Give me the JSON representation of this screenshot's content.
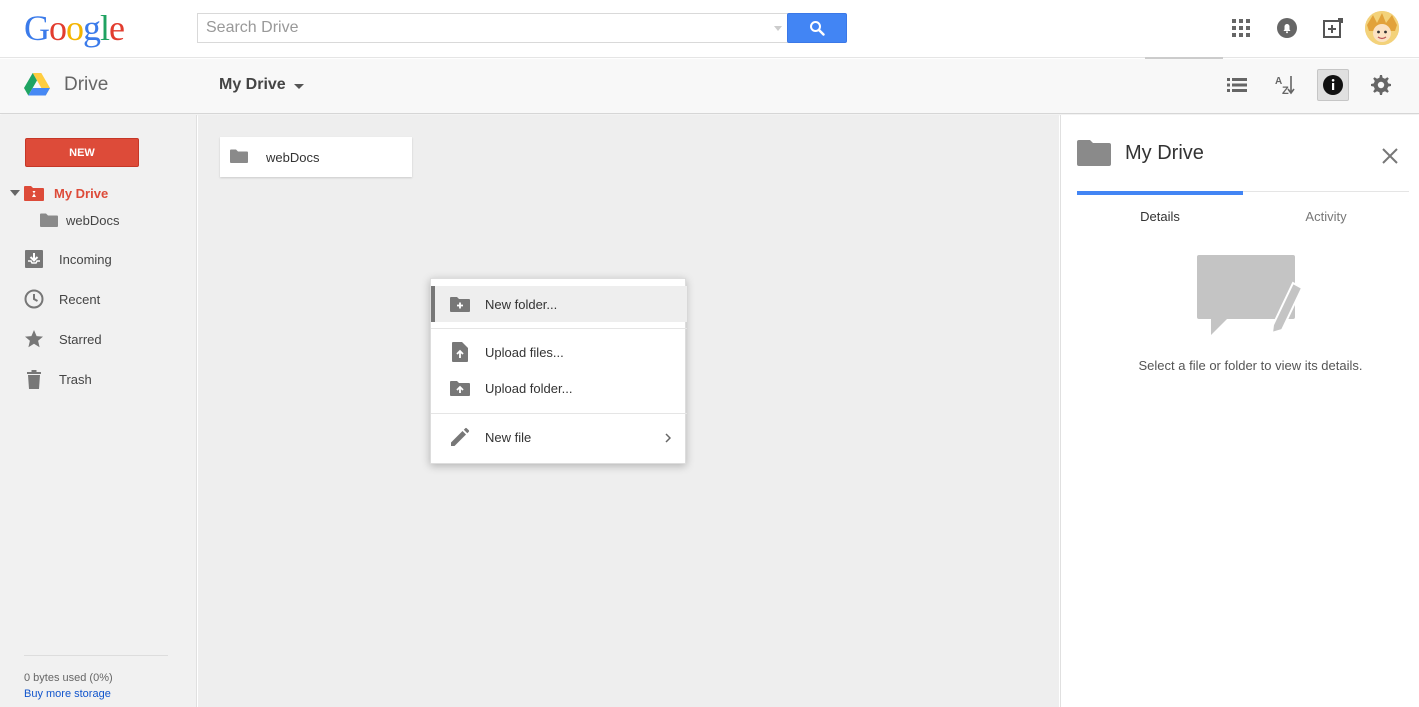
{
  "header": {
    "logo_letters": [
      {
        "char": "G",
        "color": "#3b7bea"
      },
      {
        "char": "o",
        "color": "#e23c2e"
      },
      {
        "char": "o",
        "color": "#f4b400"
      },
      {
        "char": "g",
        "color": "#3b7bea"
      },
      {
        "char": "l",
        "color": "#1fa261"
      },
      {
        "char": "e",
        "color": "#e23c2e"
      }
    ],
    "search": {
      "placeholder": "Search Drive",
      "value": ""
    },
    "icons": [
      "apps-grid-icon",
      "notifications-icon",
      "share-add-icon",
      "avatar"
    ]
  },
  "subbar": {
    "app_name": "Drive",
    "location_title": "My Drive",
    "view_icons": [
      "list-view-icon",
      "sort-az-icon",
      "info-icon",
      "settings-icon"
    ]
  },
  "sidebar": {
    "new_label": "NEW",
    "items": [
      {
        "label": "My Drive",
        "icon": "drive-folder-icon"
      },
      {
        "label": "webDocs",
        "icon": "folder-icon"
      },
      {
        "label": "Incoming",
        "icon": "incoming-icon"
      },
      {
        "label": "Recent",
        "icon": "clock-icon"
      },
      {
        "label": "Starred",
        "icon": "star-icon"
      },
      {
        "label": "Trash",
        "icon": "trash-icon"
      }
    ],
    "storage_used": "0 bytes used (0%)",
    "buy_storage": "Buy more storage"
  },
  "main": {
    "folders": [
      {
        "label": "webDocs"
      }
    ]
  },
  "context_menu": {
    "items": [
      {
        "label": "New folder...",
        "icon": "new-folder-icon",
        "highlighted": true
      },
      {
        "label": "Upload files...",
        "icon": "upload-file-icon"
      },
      {
        "label": "Upload folder...",
        "icon": "upload-folder-icon"
      },
      {
        "label": "New file",
        "icon": "pencil-icon",
        "has_submenu": true
      }
    ]
  },
  "details": {
    "title": "My Drive",
    "tabs": [
      "Details",
      "Activity"
    ],
    "active_tab": "Details",
    "empty_message": "Select a file or folder to view its details."
  },
  "colors": {
    "accent_blue": "#4285f4",
    "new_button_red": "#dd4b39",
    "link_blue": "#1155cc"
  }
}
